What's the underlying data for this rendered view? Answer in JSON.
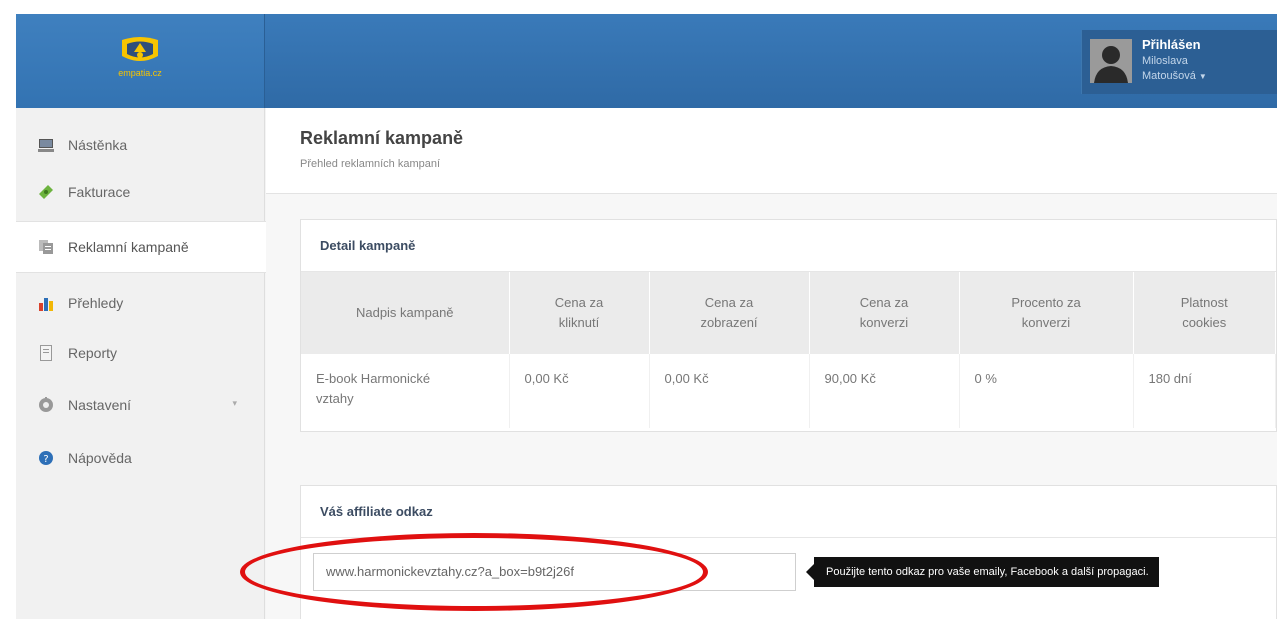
{
  "header": {
    "logo_text": "empatia.cz",
    "user": {
      "status": "Přihlášen",
      "first_name": "Miloslava",
      "last_name": "Matoušová",
      "caret": "▼"
    }
  },
  "sidebar": {
    "items": [
      {
        "label": "Nástěnka",
        "icon": "monitor-icon"
      },
      {
        "label": "Fakturace",
        "icon": "money-icon"
      },
      {
        "label": "Reklamní kampaně",
        "icon": "copy-icon",
        "active": true
      },
      {
        "label": "Přehledy",
        "icon": "bar-chart-icon"
      },
      {
        "label": "Reporty",
        "icon": "document-icon"
      },
      {
        "label": "Nastavení",
        "icon": "gear-icon",
        "arrow": "▾"
      },
      {
        "label": "Nápověda",
        "icon": "help-icon"
      }
    ]
  },
  "page": {
    "title": "Reklamní kampaně",
    "subtitle": "Přehled reklamních kampaní"
  },
  "detail_panel": {
    "title": "Detail kampaně",
    "columns": [
      [
        "Nadpis kampaně"
      ],
      [
        "Cena za",
        "kliknutí"
      ],
      [
        "Cena za",
        "zobrazení"
      ],
      [
        "Cena za",
        "konverzi"
      ],
      [
        "Procento za",
        "konverzi"
      ],
      [
        "Platnost",
        "cookies"
      ]
    ],
    "row": {
      "title_line1": "E-book Harmonické",
      "title_line2": "vztahy",
      "click_price": "0,00 Kč",
      "view_price": "0,00 Kč",
      "conversion_price": "90,00 Kč",
      "conversion_percent": "0 %",
      "cookies": "180 dní"
    }
  },
  "affiliate_panel": {
    "title": "Váš affiliate odkaz",
    "link": "www.harmonickevztahy.cz?a_box=b9t2j26f",
    "tooltip": "Použijte tento odkaz pro vaše emaily, Facebook a další propagaci."
  },
  "colors": {
    "header_blue": "#3373b2",
    "logo_yellow": "#f7c400",
    "highlight_red": "#e01010"
  }
}
